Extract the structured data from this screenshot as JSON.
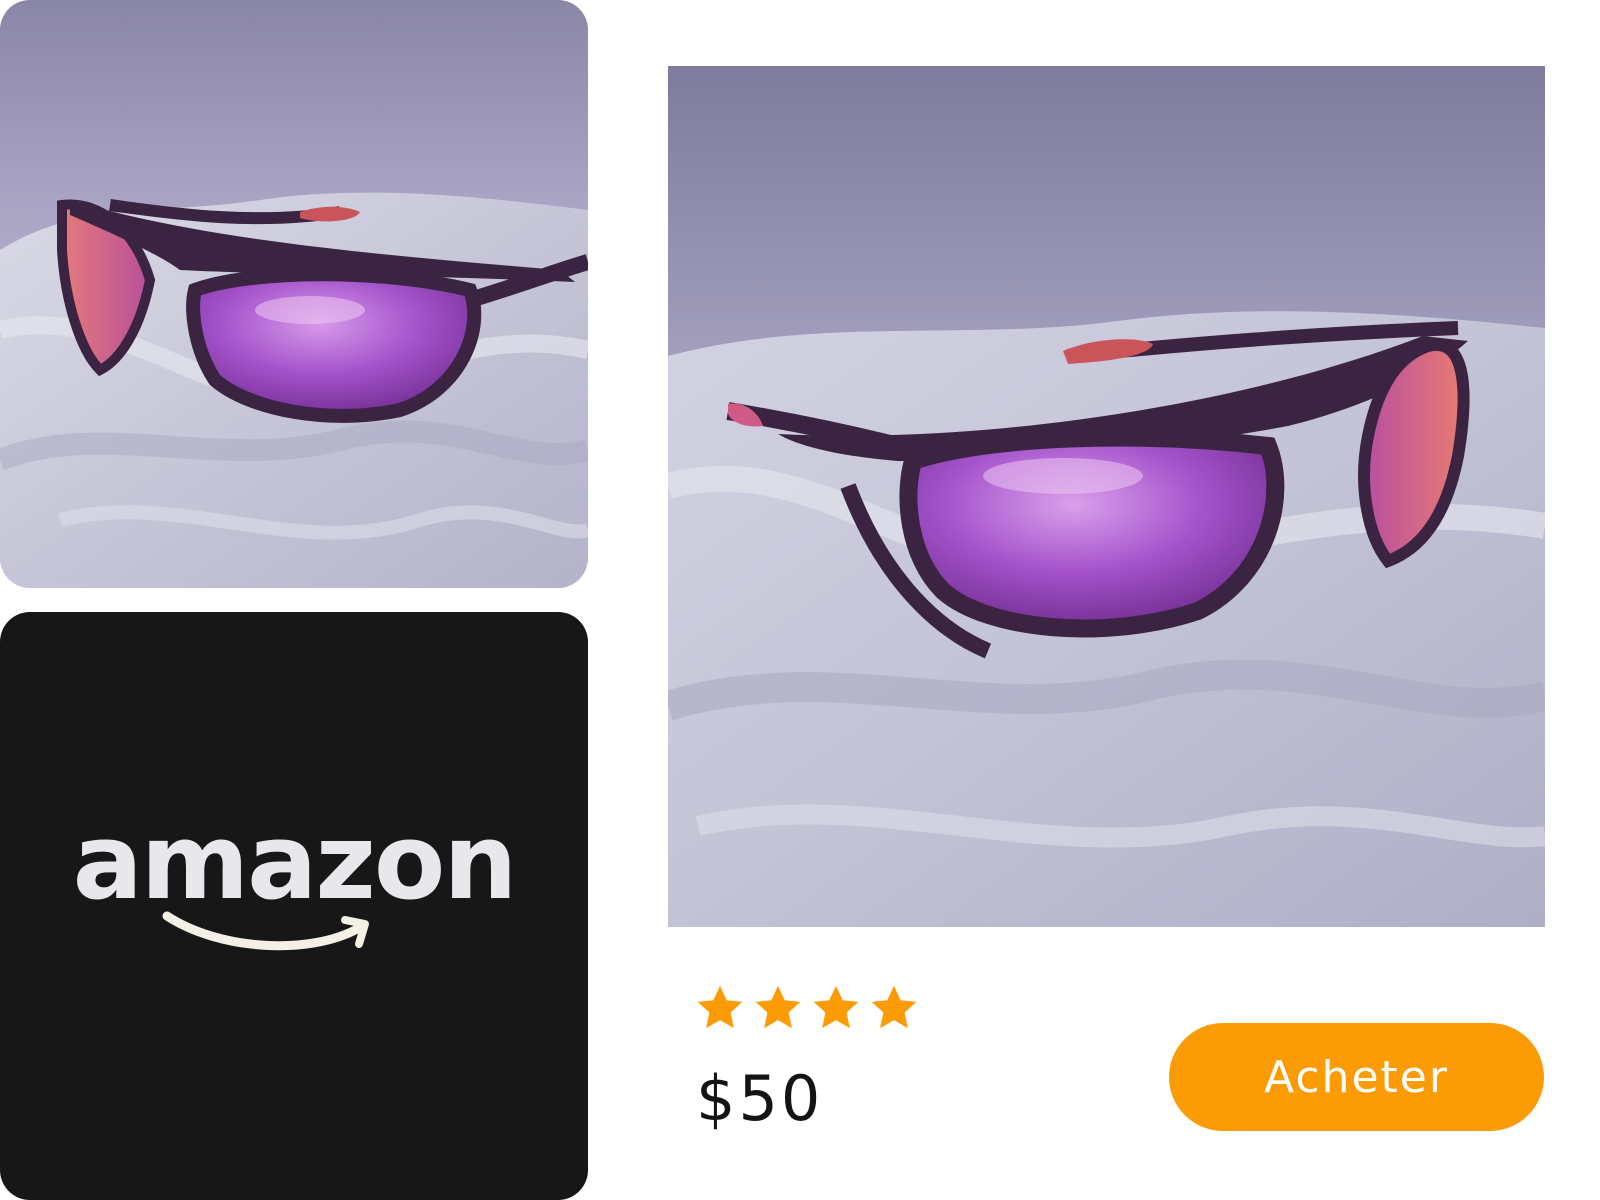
{
  "thumbnail": {
    "alt": "purple sunglasses on satin",
    "icon": "product-photo"
  },
  "brand": {
    "name": "amazon",
    "icon": "amazon-smile-arrow"
  },
  "product": {
    "rating": {
      "value": 4,
      "max": 4,
      "icon": "star-icon",
      "color": "#fb9b05"
    },
    "price": "$50",
    "buy_label": "Acheter",
    "buy_color": "#fb9b05"
  },
  "colors": {
    "background": "#ffffff",
    "logo_card": "#171717",
    "accent": "#fb9b05",
    "lens": "#a455c8",
    "frame": "#3a2240"
  }
}
